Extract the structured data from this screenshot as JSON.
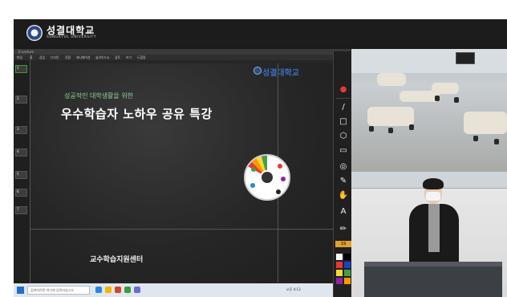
{
  "header": {
    "logo_name": "성결대학교",
    "logo_sub": "SUNGKYUL UNIVERSITY"
  },
  "app": {
    "title": "E-Lecture",
    "menu": [
      "파일",
      "홈",
      "삽입",
      "디자인",
      "전환",
      "애니메이션",
      "슬라이드쇼",
      "검토",
      "보기",
      "도움말"
    ],
    "thumbs": [
      "1",
      "2",
      "3",
      "4",
      "5",
      "6",
      "7"
    ]
  },
  "slide": {
    "logo": "성결대학교",
    "subtitle": "성공적인 대학생활을 위한",
    "title": "우수학습자 노하우 공유 특강",
    "department": "교수학습지원센터"
  },
  "taskbar": {
    "search_placeholder": "검색하려면 여기에 입력하십시오",
    "tray": "오후 4:13"
  },
  "toolbar": {
    "text_tool": "A",
    "thickness": "19"
  },
  "colors": {
    "accent": "#e53935",
    "green_subtitle": "#8fd19e",
    "taskbar": "#dfe6ee"
  }
}
